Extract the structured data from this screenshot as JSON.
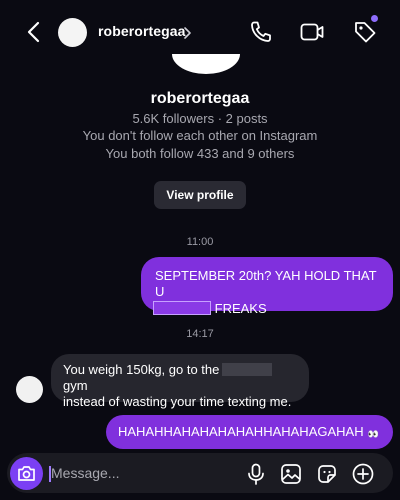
{
  "header": {
    "username": "roberortegaa",
    "icons": [
      "back-icon",
      "chevron-right-icon",
      "phone-icon",
      "video-icon",
      "tag-icon"
    ],
    "accent": "#8e6dfc"
  },
  "profile": {
    "name": "roberortegaa",
    "stats": "5.6K followers · 2 posts",
    "follow_status": "You don't follow each other on Instagram",
    "mutual": "You both follow 433 and 9 others",
    "view_profile_label": "View profile"
  },
  "messages": [
    {
      "time": "11:00",
      "direction": "outgoing",
      "line1": "SEPTEMBER 20th? YAH HOLD THAT U",
      "line2": "FREAKS"
    },
    {
      "time": "14:17",
      "direction": "incoming",
      "line1_pre": "You weigh 150kg, go to the",
      "line1_post": "gym",
      "line2": "instead of wasting your time texting me."
    },
    {
      "direction": "outgoing",
      "text": "HAHAHHAHAHAHAHAHHAHAHAGAHAH"
    }
  ],
  "composer": {
    "placeholder": "Message...",
    "icons": [
      "camera-icon",
      "microphone-icon",
      "image-icon",
      "sticker-icon",
      "plus-icon"
    ]
  },
  "colors": {
    "background": "#0a0a12",
    "outgoing_bubble": "#8030dd",
    "incoming_bubble": "#26262e",
    "camera_button": "#7b3ff4"
  }
}
